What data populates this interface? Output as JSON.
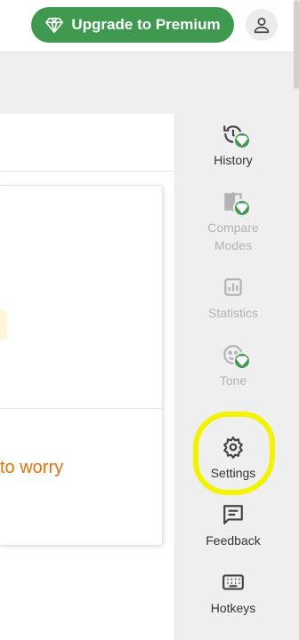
{
  "header": {
    "upgrade_label": "Upgrade to Premium",
    "upgrade_color": "#3f9a4f"
  },
  "editor": {
    "visible_text": "to worry"
  },
  "sidebar": {
    "items": [
      {
        "label": "History",
        "icon": "history-icon",
        "premium": true,
        "enabled": true
      },
      {
        "label": "Compare Modes",
        "icon": "compare-modes-icon",
        "premium": true,
        "enabled": false
      },
      {
        "label": "Statistics",
        "icon": "statistics-icon",
        "premium": false,
        "enabled": false
      },
      {
        "label": "Tone",
        "icon": "tone-icon",
        "premium": true,
        "enabled": false
      },
      {
        "label": "Settings",
        "icon": "gear-icon",
        "premium": false,
        "enabled": true,
        "highlighted": true
      },
      {
        "label": "Feedback",
        "icon": "feedback-icon",
        "premium": false,
        "enabled": true
      },
      {
        "label": "Hotkeys",
        "icon": "keyboard-icon",
        "premium": false,
        "enabled": true
      }
    ]
  },
  "colors": {
    "accent": "#3f9a4f",
    "orange_text": "#e5730f",
    "highlight_marker": "#f3f300"
  }
}
